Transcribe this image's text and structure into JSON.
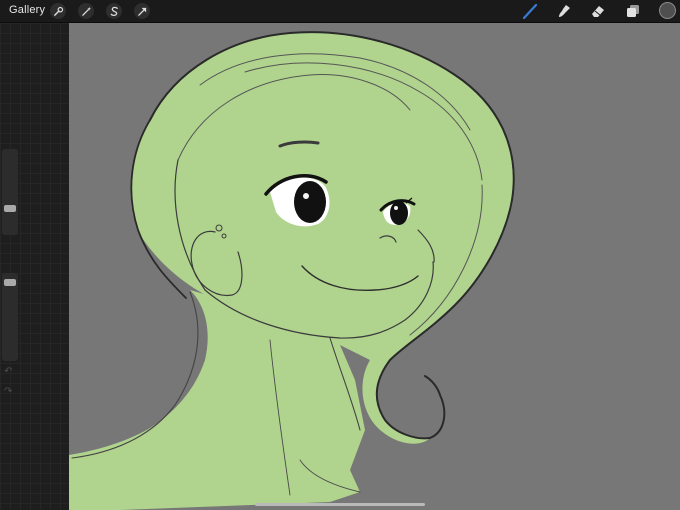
{
  "toolbar": {
    "gallery_label": "Gallery",
    "left_tools": [
      {
        "icon": "wrench-icon"
      },
      {
        "icon": "magic-wand-icon"
      },
      {
        "icon": "selection-icon"
      },
      {
        "icon": "transform-arrow-icon"
      }
    ],
    "right_tools": [
      {
        "icon": "brush-icon",
        "active": true,
        "color": "#3a7bd5"
      },
      {
        "icon": "smudge-icon"
      },
      {
        "icon": "eraser-icon"
      },
      {
        "icon": "layers-icon"
      }
    ],
    "current_color": "#4f4f4f"
  },
  "sidebar": {
    "brush_size_level": 0.68,
    "brush_opacity_level": 0.08
  },
  "canvas": {
    "background_color": "#777777",
    "fill_color": "#b0d48e",
    "line_color": "#1e1e1e"
  }
}
